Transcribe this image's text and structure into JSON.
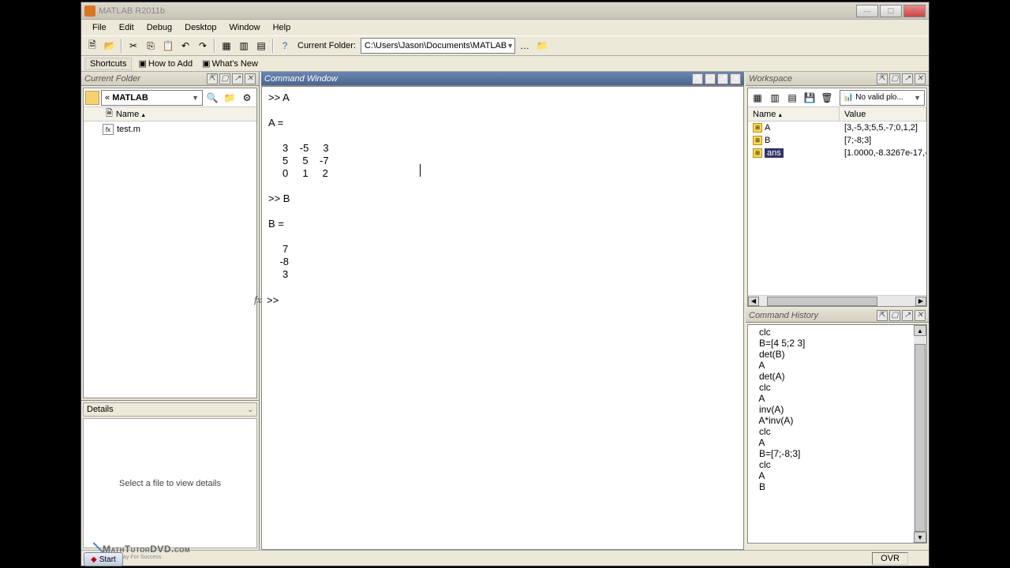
{
  "title": "MATLAB R2011b",
  "menubar": [
    "File",
    "Edit",
    "Debug",
    "Desktop",
    "Window",
    "Help"
  ],
  "toolbar": {
    "current_folder_label": "Current Folder:",
    "current_folder_path": "C:\\Users\\Jason\\Documents\\MATLAB"
  },
  "shortcuts": {
    "label": "Shortcuts",
    "links": [
      "How to Add",
      "What's New"
    ]
  },
  "current_folder_panel": {
    "title": "Current Folder",
    "breadcrumb_prefix": "«",
    "breadcrumb": "MATLAB",
    "name_header": "Name",
    "items": [
      {
        "name": "test.m"
      }
    ],
    "details_title": "Details",
    "details_empty": "Select a file to view details"
  },
  "command_window": {
    "title": "Command Window",
    "content": ">> A\n\nA =\n\n     3    -5     3\n     5     5    -7\n     0     1     2\n\n>> B\n\nB =\n\n     7\n    -8\n     3\n\n",
    "prompt": ">> "
  },
  "workspace": {
    "title": "Workspace",
    "plot_combo": "No valid plo...",
    "headers": {
      "name": "Name",
      "value": "Value"
    },
    "vars": [
      {
        "name": "A",
        "value": "[3,-5,3;5,5,-7;0,1,2]",
        "selected": false
      },
      {
        "name": "B",
        "value": "[7;-8;3]",
        "selected": false
      },
      {
        "name": "ans",
        "value": "[1.0000,-8.3267e-17,-...",
        "selected": true
      }
    ]
  },
  "command_history": {
    "title": "Command History",
    "entries": [
      "clc",
      "B=[4 5;2 3]",
      "det(B)",
      "A",
      "det(A)",
      "clc",
      "A",
      "inv(A)",
      "A*inv(A)",
      "clc",
      "A",
      "B=[7;-8;3]",
      "clc",
      "A",
      "B"
    ]
  },
  "statusbar": {
    "ovr": "OVR"
  },
  "watermark": {
    "text": "MathTutorDVD.com",
    "tagline": "Press Play For Success"
  },
  "start_button": "Start"
}
